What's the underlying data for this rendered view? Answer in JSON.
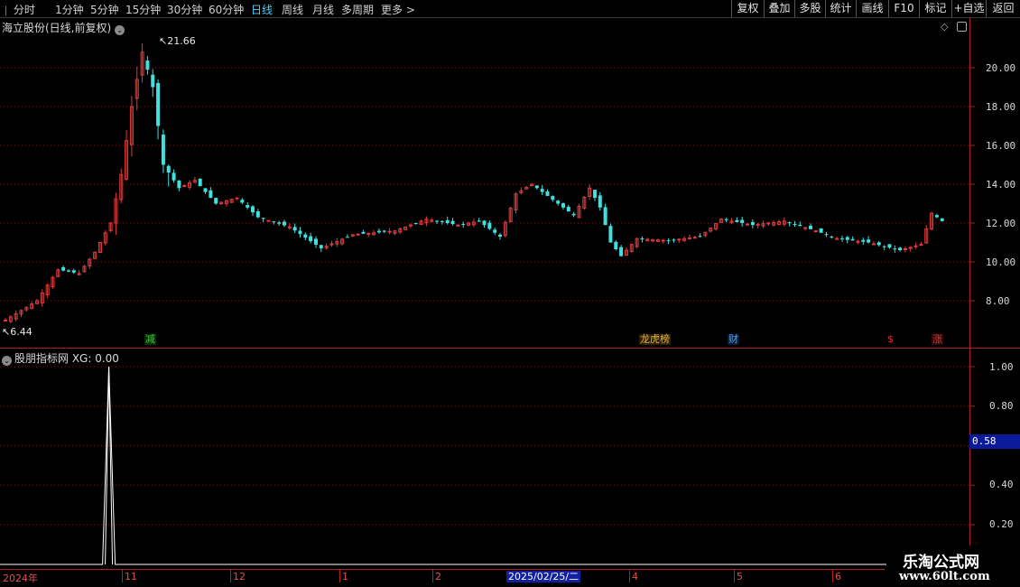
{
  "toolbar": {
    "periods": [
      {
        "label": "分时",
        "active": false
      },
      {
        "label": "1分钟",
        "active": false
      },
      {
        "label": "5分钟",
        "active": false
      },
      {
        "label": "15分钟",
        "active": false
      },
      {
        "label": "30分钟",
        "active": false
      },
      {
        "label": "60分钟",
        "active": false
      },
      {
        "label": "日线",
        "active": true
      },
      {
        "label": "周线",
        "active": false
      },
      {
        "label": "月线",
        "active": false
      },
      {
        "label": "多周期",
        "active": false
      }
    ],
    "more_label": "更多 >",
    "right_buttons": [
      "复权",
      "叠加",
      "多股",
      "统计",
      "画线",
      "F10",
      "标记",
      "+自选",
      "返回"
    ]
  },
  "main_chart": {
    "title": "海立股份(日线,前复权)",
    "price_axis": [
      "20.00",
      "18.00",
      "16.00",
      "14.00",
      "12.00",
      "10.00",
      "8.00"
    ],
    "high_note": "21.66",
    "low_note": "6.44",
    "event_tags": [
      {
        "text": "减",
        "color": "#3cc43c"
      },
      {
        "text": "龙虎榜",
        "color": "#e8b030"
      },
      {
        "text": "财",
        "color": "#40a0ff"
      },
      {
        "text": "$",
        "color": "#e03030"
      },
      {
        "text": "涨",
        "color": "#e03030"
      }
    ]
  },
  "sub_chart": {
    "title": "股朋指标网 XG: 0.00",
    "value_axis": [
      "1.00",
      "0.80",
      "0.40",
      "0.20"
    ],
    "current_value": "0.58"
  },
  "date_axis": {
    "ticks": [
      "2024年",
      "11",
      "12",
      "1",
      "2",
      "4",
      "5",
      "6"
    ],
    "cursor_label": "2025/02/25/二"
  },
  "watermark": {
    "name": "乐淘公式网",
    "url": "www.60lt.com"
  },
  "colors": {
    "up": "#e03a3a",
    "down": "#40e0e0",
    "grid": "#7a1818",
    "background": "#000000"
  },
  "chart_data": {
    "type": "candlestick",
    "title": "海立股份(日线,前复权)",
    "y_range": [
      6.0,
      22.5
    ],
    "high": 21.66,
    "low": 6.44,
    "x_ticks": [
      "2024年",
      "11",
      "12",
      "1",
      "2",
      "4",
      "5",
      "6"
    ],
    "sub_series": {
      "name": "XG",
      "y_range": [
        0.1,
        1.05
      ],
      "signal_index": 26,
      "signal_value": 1.0
    }
  }
}
